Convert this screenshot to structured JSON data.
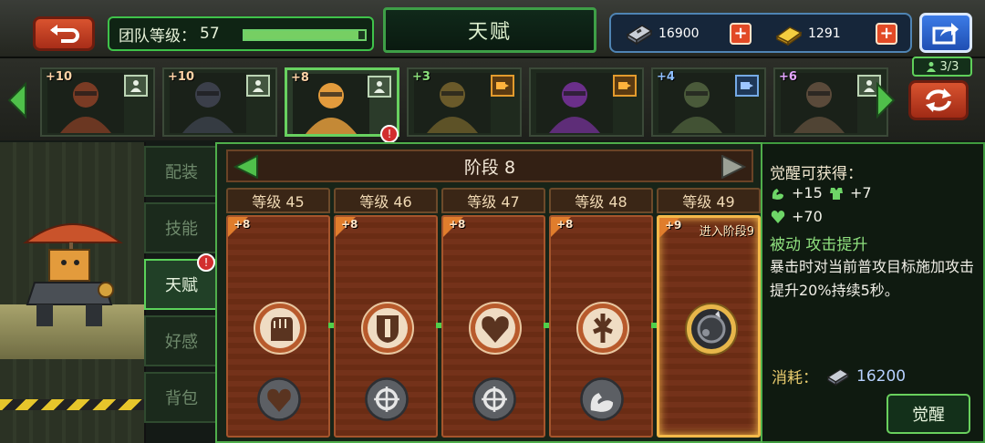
{
  "top": {
    "team_level_label": "团队等级：",
    "team_level_value": "57",
    "team_xp_progress": 0.95,
    "title": "天赋",
    "currency_chips": "16900",
    "currency_gold": "1291"
  },
  "heroes": [
    {
      "level": "+10",
      "role": "person",
      "portrait": "soldier-cowboy-hat"
    },
    {
      "level": "+10",
      "role": "person",
      "portrait": "armored-robot-soldier"
    },
    {
      "level": "+8",
      "role": "person",
      "portrait": "cat-mech-pilot",
      "selected": true,
      "badge": "!"
    },
    {
      "level": "+3",
      "role": "vehicle",
      "portrait": "gasmask-soldier"
    },
    {
      "level": "",
      "role": "vehicle",
      "portrait": "purple-mech-creature"
    },
    {
      "level": "+4",
      "role": "robot",
      "portrait": "commando-soldier"
    },
    {
      "level": "+6",
      "role": "person",
      "portrait": "masked-woman-soldier"
    }
  ],
  "team_count": "3/3",
  "side_tabs": [
    "配装",
    "技能",
    "天赋",
    "好感",
    "背包"
  ],
  "active_tab": "天赋",
  "stage": {
    "label": "阶段 8",
    "columns": [
      {
        "level_label": "等级 45",
        "plus": "+8",
        "main_icon": "fist-icon",
        "sub_icon": "heart-icon"
      },
      {
        "level_label": "等级 46",
        "plus": "+8",
        "main_icon": "shield-icon",
        "sub_icon": "crosshair-icon"
      },
      {
        "level_label": "等级 47",
        "plus": "+8",
        "main_icon": "heart-icon",
        "sub_icon": "crosshair-icon"
      },
      {
        "level_label": "等级 48",
        "plus": "+8",
        "main_icon": "burst-icon",
        "sub_icon": "flex-arm-icon"
      },
      {
        "level_label": "等级 49",
        "plus": "+9",
        "note": "进入阶段9",
        "main_icon": "gear-orb-icon",
        "current": true
      }
    ]
  },
  "info": {
    "title": "觉醒可获得：",
    "stats": [
      {
        "icon": "flex-arm-icon",
        "value": "+15"
      },
      {
        "icon": "armor-icon",
        "value": "+7"
      },
      {
        "icon": "heart-icon",
        "value": "+70"
      }
    ],
    "skill_name": "被动 攻击提升",
    "skill_desc": "暴击时对当前普攻目标施加攻击提升20%持续5秒。",
    "cost_label": "消耗：",
    "cost_value": "16200",
    "awaken_button": "觉醒"
  },
  "colors": {
    "panel_green": "#4fae4b",
    "card_brown": "#6a2c14",
    "current_gold": "#f4b94a",
    "button_red": "#d9532f"
  }
}
